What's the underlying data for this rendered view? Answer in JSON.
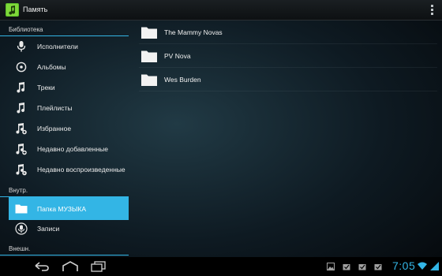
{
  "app": {
    "title": "Память",
    "icon": "music-app-icon"
  },
  "sidebar": {
    "library_header": "Библиотека",
    "library_items": [
      {
        "label": "Исполнители",
        "icon": "microphone-icon"
      },
      {
        "label": "Альбомы",
        "icon": "disc-icon"
      },
      {
        "label": "Треки",
        "icon": "music-note-icon"
      },
      {
        "label": "Плейлисты",
        "icon": "music-note-icon"
      },
      {
        "label": "Избранное",
        "icon": "music-note-star-icon"
      },
      {
        "label": "Недавно добавленные",
        "icon": "music-note-plus-icon"
      },
      {
        "label": "Недавно воспроизведенные",
        "icon": "music-note-play-icon"
      }
    ],
    "internal_header": "Внутр.",
    "internal_items": [
      {
        "label": "Папка МУЗЫКА",
        "icon": "folder-icon",
        "selected": true
      },
      {
        "label": "Записи",
        "icon": "microphone-icon",
        "selected": false
      }
    ],
    "external_header": "Внешн."
  },
  "folders": [
    {
      "label": "The Mammy Novas"
    },
    {
      "label": "PV Nova"
    },
    {
      "label": "Wes Burden"
    }
  ],
  "status_bar": {
    "time": "7:05"
  },
  "colors": {
    "accent": "#33b5e5",
    "background": "#0e1a22"
  }
}
